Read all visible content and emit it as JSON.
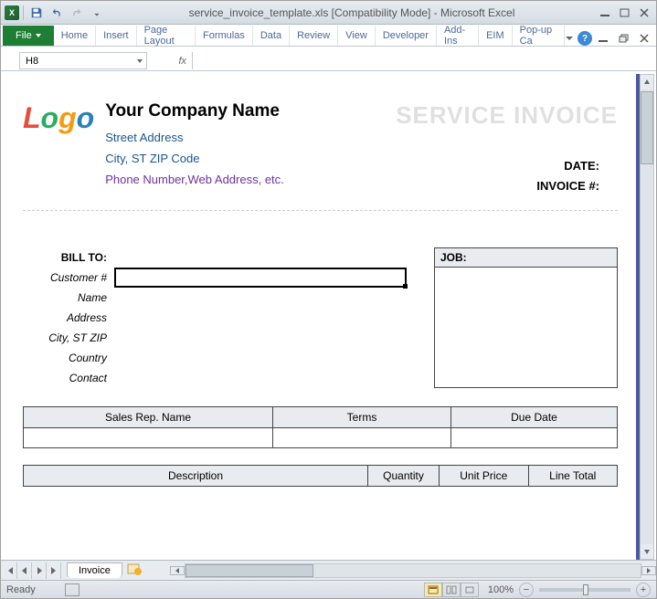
{
  "titlebar": {
    "title": "service_invoice_template.xls  [Compatibility Mode]  -  Microsoft Excel"
  },
  "ribbon": {
    "file": "File",
    "tabs": [
      "Home",
      "Insert",
      "Page Layout",
      "Formulas",
      "Data",
      "Review",
      "View",
      "Developer",
      "Add-Ins",
      "EIM",
      "Pop-up Ca"
    ]
  },
  "formula_bar": {
    "cell_ref": "H8",
    "fx": "fx"
  },
  "invoice": {
    "company_name": "Your Company Name",
    "street": "Street Address",
    "citystzip": "City, ST  ZIP Code",
    "contact": "Phone Number,Web Address, etc.",
    "title": "SERVICE INVOICE",
    "date_label": "DATE:",
    "invno_label": "INVOICE #:",
    "billto": {
      "header": "BILL TO:",
      "customer_no": "Customer #",
      "name": "Name",
      "address": "Address",
      "citystzip": "City, ST ZIP",
      "country": "Country",
      "contact": "Contact"
    },
    "job_header": "JOB:",
    "table1": {
      "sales_rep": "Sales Rep. Name",
      "terms": "Terms",
      "due_date": "Due Date"
    },
    "table2": {
      "description": "Description",
      "quantity": "Quantity",
      "unit_price": "Unit Price",
      "line_total": "Line Total"
    }
  },
  "sheet_tabs": {
    "name": "Invoice"
  },
  "statusbar": {
    "ready": "Ready",
    "zoom": "100%"
  }
}
